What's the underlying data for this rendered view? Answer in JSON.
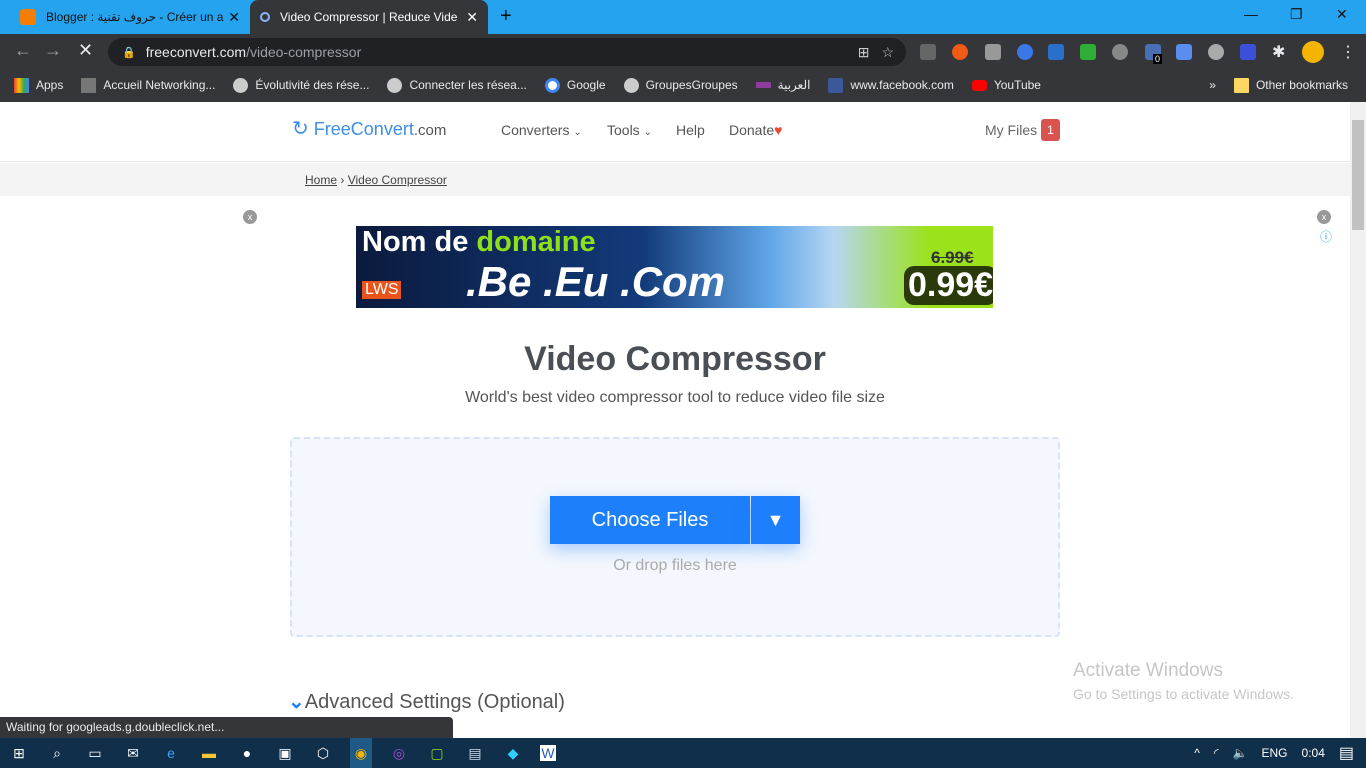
{
  "browser": {
    "tabs": [
      {
        "title": "Blogger : حروف تقنية - Créer un a",
        "favicon": "blogger-icon",
        "active": false
      },
      {
        "title": "Video Compressor | Reduce Vide",
        "favicon": "loading-spinner-icon",
        "active": true
      }
    ],
    "url_domain": "freeconvert.com",
    "url_path": "/video-compressor",
    "bookmarks": [
      {
        "label": "Apps"
      },
      {
        "label": "Accueil Networking..."
      },
      {
        "label": "Évolutivité des rése..."
      },
      {
        "label": "Connecter les résea..."
      },
      {
        "label": "Google"
      },
      {
        "label": "GroupesGroupes"
      },
      {
        "label": "العربية"
      },
      {
        "label": "www.facebook.com"
      },
      {
        "label": "YouTube"
      }
    ],
    "other_bookmarks": "Other bookmarks",
    "extension_badge": "0",
    "status": "Waiting for googleads.g.doubleclick.net..."
  },
  "site": {
    "logo_main": "FreeConvert",
    "logo_suffix": ".com",
    "nav": [
      {
        "label": "Converters"
      },
      {
        "label": "Tools"
      },
      {
        "label": "Help"
      },
      {
        "label": "Donate"
      }
    ],
    "my_files": "My Files",
    "my_files_count": "1",
    "breadcrumb": [
      "Home",
      "Video Compressor"
    ],
    "ad": {
      "line1a": "Nom de ",
      "line1b": "domaine",
      "line2": ".Be .Eu .Com",
      "old_price": "6.99€",
      "price": "0.99€",
      "brand": "LWS",
      "close": "x"
    },
    "title": "Video Compressor",
    "subtitle": "World's best video compressor tool to reduce video file size",
    "choose_files": "Choose Files",
    "drop_hint": "Or drop files here",
    "advanced": "Advanced Settings (Optional)",
    "accent": "#1e7ffc"
  },
  "watermark": {
    "title": "Activate Windows",
    "subtitle": "Go to Settings to activate Windows."
  },
  "taskbar": {
    "lang": "ENG",
    "time": "0:04"
  }
}
